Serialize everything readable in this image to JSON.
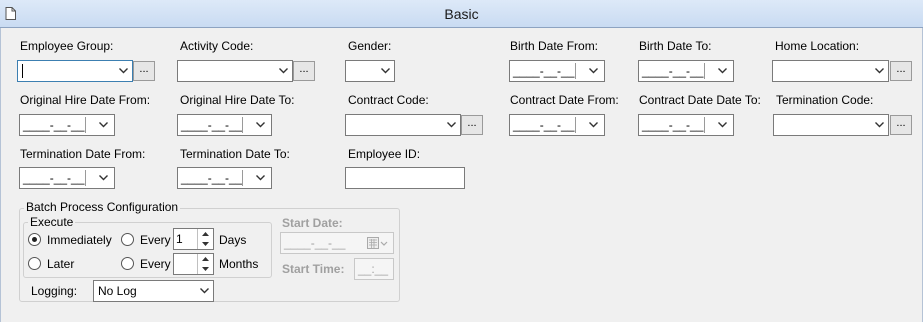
{
  "window": {
    "title": "Basic",
    "icon": "document-icon"
  },
  "fields": {
    "employee_group": {
      "label": "Employee Group:",
      "value": ""
    },
    "activity_code": {
      "label": "Activity Code:",
      "value": ""
    },
    "gender": {
      "label": "Gender:",
      "value": ""
    },
    "birth_date_from": {
      "label": "Birth Date From:",
      "value": "____-__-__"
    },
    "birth_date_to": {
      "label": "Birth Date To:",
      "value": "____-__-__"
    },
    "home_location": {
      "label": "Home Location:",
      "value": ""
    },
    "original_hire_from": {
      "label": "Original Hire Date From:",
      "value": "____-__-__"
    },
    "original_hire_to": {
      "label": "Original Hire Date To:",
      "value": "____-__-__"
    },
    "contract_code": {
      "label": "Contract Code:",
      "value": ""
    },
    "contract_date_from": {
      "label": "Contract Date From:",
      "value": "____-__-__"
    },
    "contract_date_to": {
      "label": "Contract Date Date To:",
      "value": "____-__-__"
    },
    "termination_code": {
      "label": "Termination Code:",
      "value": ""
    },
    "termination_date_from": {
      "label": "Termination Date From:",
      "value": "____-__-__"
    },
    "termination_date_to": {
      "label": "Termination Date To:",
      "value": "____-__-__"
    },
    "employee_id": {
      "label": "Employee ID:",
      "value": ""
    }
  },
  "ellipsis_label": "...",
  "batch": {
    "title": "Batch Process Configuration",
    "execute_title": "Execute",
    "immediately": "Immediately",
    "later": "Later",
    "every": "Every",
    "days_value": "1",
    "days_label": "Days",
    "months_value": "",
    "months_label": "Months",
    "selected": "Immediately",
    "start_date_label": "Start Date:",
    "start_date_value": "____-__-__",
    "start_time_label": "Start Time:",
    "start_time_value": "__:__",
    "logging_label": "Logging:",
    "logging_value": "No Log"
  }
}
